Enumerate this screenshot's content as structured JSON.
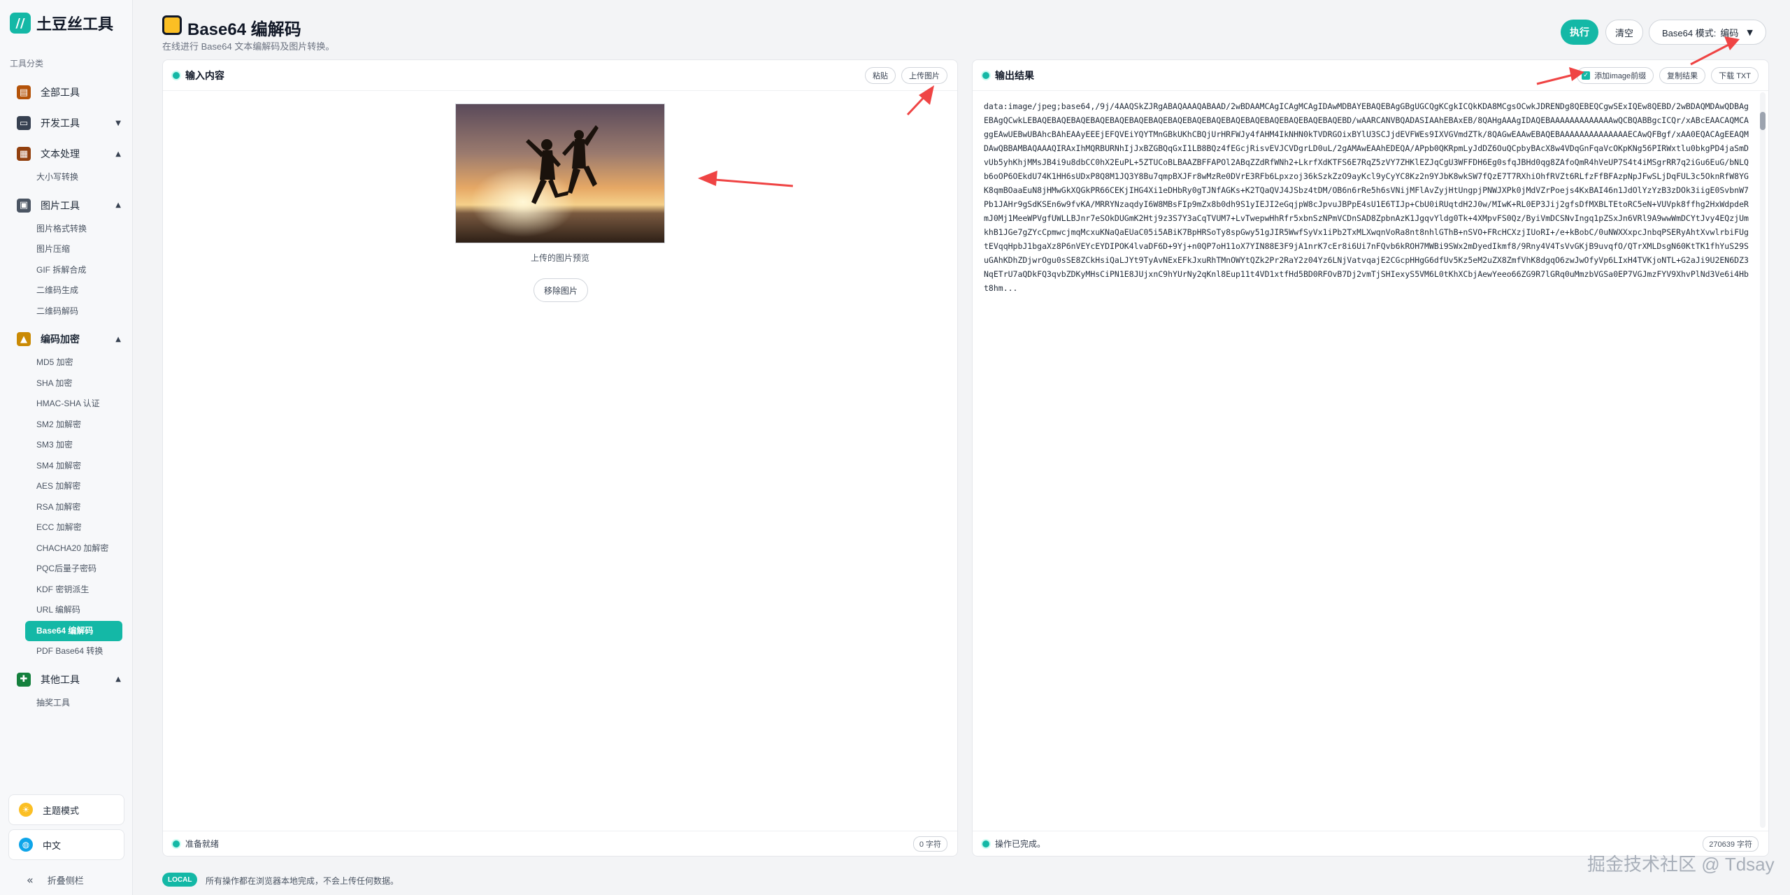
{
  "app": {
    "logo_glyph": "//",
    "name": "土豆丝工具"
  },
  "sidebar": {
    "section_label": "工具分类",
    "categories": [
      {
        "label": "全部工具",
        "icon": "book-icon",
        "color": "#b45309"
      },
      {
        "label": "开发工具",
        "icon": "laptop-icon",
        "color": "#374151",
        "arrow": "▼"
      },
      {
        "label": "文本处理",
        "icon": "notebook-icon",
        "color": "#92400e",
        "arrow": "▲",
        "subs": [
          "大小写转换"
        ]
      },
      {
        "label": "图片工具",
        "icon": "image-icon",
        "color": "#4b5563",
        "arrow": "▲",
        "subs": [
          "图片格式转换",
          "图片压缩",
          "GIF 拆解合成",
          "二维码生成",
          "二维码解码"
        ]
      },
      {
        "label": "编码加密",
        "icon": "lock-icon",
        "color": "#ca8a04",
        "arrow": "▲",
        "subs": [
          "MD5 加密",
          "SHA 加密",
          "HMAC-SHA 认证",
          "SM2 加解密",
          "SM3 加密",
          "SM4 加解密",
          "AES 加解密",
          "RSA 加解密",
          "ECC 加解密",
          "CHACHA20 加解密",
          "PQC后量子密码",
          "KDF 密钥派生",
          "URL 编解码",
          "Base64 编解码",
          "PDF Base64 转换"
        ]
      },
      {
        "label": "其他工具",
        "icon": "puzzle-icon",
        "color": "#15803d",
        "arrow": "▲",
        "subs": [
          "抽奖工具"
        ]
      }
    ],
    "active_sub": "Base64 编解码",
    "theme_label": "主题模式",
    "lang_label": "中文",
    "collapse_label": "折叠侧栏",
    "collapse_glyph": "«"
  },
  "header": {
    "title": "Base64 编解码",
    "subtitle": "在线进行 Base64 文本编解码及图片转换。",
    "run_label": "执行",
    "clear_label": "清空",
    "mode_label": "Base64 模式:",
    "mode_value": "编码",
    "mode_caret": "▼"
  },
  "input_panel": {
    "title": "输入内容",
    "paste_label": "粘贴",
    "upload_label": "上传图片",
    "preview_caption": "上传的图片预览",
    "remove_label": "移除图片",
    "status": "准备就绪",
    "char_count": "0 字符"
  },
  "output_panel": {
    "title": "输出结果",
    "prefix_checkbox_label": "添加image前缀",
    "prefix_checked": true,
    "copy_label": "复制结果",
    "download_label": "下载 TXT",
    "status": "操作已完成。",
    "char_count": "270639 字符",
    "content": "data:image/jpeg;base64,/9j/4AAQSkZJRgABAQAAAQABAAD/2wBDAAMCAgICAgMCAgIDAwMDBAYEBAQEBAgGBgUGCQgKCgkICQkKDA8MCgsOCwkJDRENDg8QEBEQCgwSExIQEw8QEBD/2wBDAQMDAwQDBAgEBAgQCwkLEBAQEBAQEBAQEBAQEBAQEBAQEBAQEBAQEBAQEBAQEBAQEBAQEBAQEBAQEBAQEBAQEBD/wAARCANVBQADASIAAhEBAxEB/8QAHgAAAgIDAQEBAAAAAAAAAAAAAwQCBQABBgcICQr/xABcEAACAQMCAggEAwUEBwUBAhcBAhEAAyEEEjEFQVEiYQYTMnGBkUKhCBQjUrHRFWJy4fAHM4IkNHN0kTVDRGOixBYlU3SCJjdEVFWEs9IXVGVmdZTk/8QAGwEAAwEBAQEBAAAAAAAAAAAAAAECAwQFBgf/xAA0EQACAgEEAQMDAwQBBAMBAQAAAQIRAxIhMQRBURNhIjJxBZGBQqGxI1LB8BQz4fEGcjRisvEVJCVDgrLD0uL/2gAMAwEAAhEDEQA/APpb0QKRpmLyJdDZ6OuQCpbyBAcX8w4VDqGnFqaVcOKpKNg56PIRWxtlu0bkgPD4jaSmDvUb5yhKhjMMsJB4i9u8dbCC0hX2EuPL+5ZTUCoBLBAAZBFFAPOl2ABqZZdRfWNh2+LkrfXdKTFS6E7RqZ5zVY7ZHKlEZJqCgU3WFFDH6Eg0sfqJBHd0qg8ZAfoQmR4hVeUP7S4t4iMSgrRR7q2iGu6EuG/bNLQb6oOP6OEkdU74K1HH6sUDxP8Q8M1JQ3Y8Bu7qmpBXJFr8wMzRe0DVrE3RFb6Lpxzoj36kSzkZzO9ayKcl9yCyYC8Kz2n9YJbK8wkSW7fQzE7T7RXhiOhfRVZt6RLfzFfBFAzpNpJFwSLjDqFUL3c5OknRfW8YGK8qmBOaaEuN8jHMwGkXQGkPR66CEKjIHG4Xi1eDHbRy0gTJNfAGKs+K2TQaQVJ4JSbz4tDM/OB6n6rRe5h6sVNijMFlAvZyjHtUngpjPNWJXPk0jMdVZrPoejs4KxBAI46n1JdOlYzYzB3zDOk3iigE0SvbnW7Pb1JAHr9gSdKSEn6w9fvKA/MRRYNzaqdyI6W8MBsFIp9mZx8b0dh9S1yIEJI2eGqjpW8cJpvuJBPpE4sU1E6TIJp+CbU0iRUqtdH2J0w/MIwK+RL0EP3Jij2gfsDfMXBLTEtoRC5eN+VUVpk8ffhg2HxWdpdeRmJ0Mj1MeeWPVgfUWLLBJnr7eSOkDUGmK2Htj9z3S7Y3aCqTVUM7+LvTwepwHhRfr5xbnSzNPmVCDnSAD8ZpbnAzK1JgqvYldg0Tk+4XMpvFS0Qz/ByiVmDCSNvIngq1pZSxJn6VRl9A9wwWmDCYtJvy4EQzjUmkhB1JGe7gZYcCpmwcjmqMcxuKNaQaEUaC05i5ABiK7BpHRSoTy8spGwy51gJIR5WwfSyVx1iPb2TxMLXwqnVoRa8nt8nhlGThB+nSVO+FRcHCXzjIUoRI+/e+kBobC/0uNWXXxpcJnbqPSERyAhtXvwlrbiFUgtEVqqHpbJ1bgaXz8P6nVEYcEYDIPOK4lvaDF6D+9Yj+n0QP7oH11oX7YIN88E3F9jA1nrK7cEr8i6Ui7nFQvb6kROH7MWBi9SWx2mDyedIkmf8/9Rny4V4TsVvGKjB9uvqfO/QTrXMLDsgN60KtTK1fhYuS29SuGAhKDhZDjwrOgu0sSE8ZCkHsiQaLJYt9TyAvNExEFkJxuRhTMnOWYtQZk2Pr2RaY2z04Yz6LNjVatvqajE2CGcpHHgG6dfUv5Kz5eM2uZX8ZmfVhK8dgqO6zwJwOfyVp6LIxH4TVKjoNTL+G2aJi9U2EN6DZ3NqETrU7aQDkFQ3qvbZDKyMHsCiPN1E8JUjxnC9hYUrNy2qKnl8Eup11t4VD1xtfHd5BD0RFOvB7Dj2vmTjSHIexyS5VM6L0tKhXCbjAewYeeo66ZG9R7lGRq0uMmzbVGSa0EP7VGJmzFYV9XhvPlNd3Ve6i4Hbt8hm..."
  },
  "footer": {
    "local_badge": "LOCAL",
    "local_note": "所有操作都在浏览器本地完成，不会上传任何数据。",
    "watermark": "掘金技术社区 @ Tdsay"
  },
  "colors": {
    "accent": "#14b8a6",
    "annotation_arrow": "#ef4444"
  }
}
